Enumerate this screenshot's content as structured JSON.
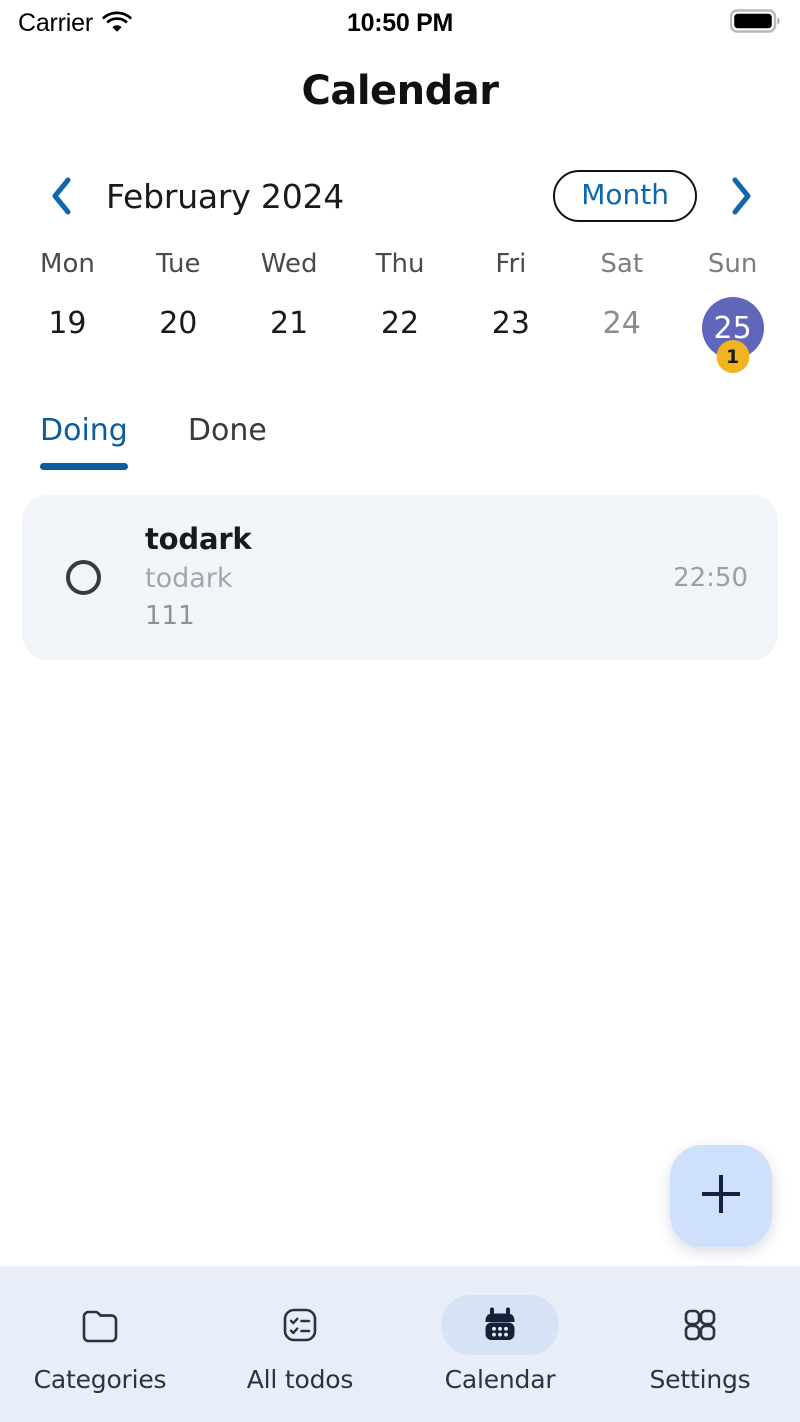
{
  "status_bar": {
    "carrier": "Carrier",
    "wifi_icon": "wifi-icon",
    "time": "10:50 PM",
    "battery_icon": "battery-full-icon"
  },
  "header": {
    "title": "Calendar"
  },
  "calendar": {
    "prev_icon": "chevron-left-icon",
    "next_icon": "chevron-right-icon",
    "month_label": "February 2024",
    "view_mode_button": "Month",
    "weekday_names": [
      "Mon",
      "Tue",
      "Wed",
      "Thu",
      "Fri",
      "Sat",
      "Sun"
    ],
    "days": [
      {
        "num": "19",
        "selected": false,
        "dim": false,
        "badge": null
      },
      {
        "num": "20",
        "selected": false,
        "dim": false,
        "badge": null
      },
      {
        "num": "21",
        "selected": false,
        "dim": false,
        "badge": null
      },
      {
        "num": "22",
        "selected": false,
        "dim": false,
        "badge": null
      },
      {
        "num": "23",
        "selected": false,
        "dim": false,
        "badge": null
      },
      {
        "num": "24",
        "selected": false,
        "dim": true,
        "badge": null
      },
      {
        "num": "25",
        "selected": true,
        "dim": false,
        "badge": "1"
      }
    ],
    "selected_day_color": "#6067ba",
    "badge_color": "#f0b321",
    "accent_color": "#0e67ac"
  },
  "tabs": [
    {
      "label": "Doing",
      "active": true
    },
    {
      "label": "Done",
      "active": false
    }
  ],
  "todos": [
    {
      "title": "todark",
      "subtitle": "todark",
      "extra": "111",
      "time": "22:50",
      "checked": false
    }
  ],
  "fab": {
    "icon": "plus-icon"
  },
  "bottom_nav": [
    {
      "label": "Categories",
      "icon": "folder-icon",
      "active": false
    },
    {
      "label": "All todos",
      "icon": "checklist-square-icon",
      "active": false
    },
    {
      "label": "Calendar",
      "icon": "calendar-filled-icon",
      "active": true
    },
    {
      "label": "Settings",
      "icon": "grid-squares-icon",
      "active": false
    }
  ]
}
